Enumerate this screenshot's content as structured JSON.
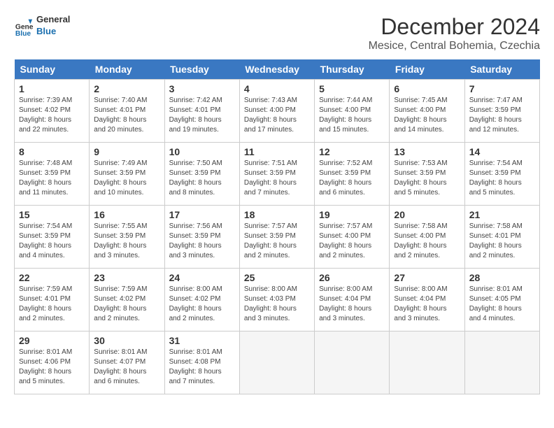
{
  "logo": {
    "line1": "General",
    "line2": "Blue"
  },
  "title": "December 2024",
  "location": "Mesice, Central Bohemia, Czechia",
  "days_header": [
    "Sunday",
    "Monday",
    "Tuesday",
    "Wednesday",
    "Thursday",
    "Friday",
    "Saturday"
  ],
  "weeks": [
    [
      {
        "num": "1",
        "info": "Sunrise: 7:39 AM\nSunset: 4:02 PM\nDaylight: 8 hours\nand 22 minutes."
      },
      {
        "num": "2",
        "info": "Sunrise: 7:40 AM\nSunset: 4:01 PM\nDaylight: 8 hours\nand 20 minutes."
      },
      {
        "num": "3",
        "info": "Sunrise: 7:42 AM\nSunset: 4:01 PM\nDaylight: 8 hours\nand 19 minutes."
      },
      {
        "num": "4",
        "info": "Sunrise: 7:43 AM\nSunset: 4:00 PM\nDaylight: 8 hours\nand 17 minutes."
      },
      {
        "num": "5",
        "info": "Sunrise: 7:44 AM\nSunset: 4:00 PM\nDaylight: 8 hours\nand 15 minutes."
      },
      {
        "num": "6",
        "info": "Sunrise: 7:45 AM\nSunset: 4:00 PM\nDaylight: 8 hours\nand 14 minutes."
      },
      {
        "num": "7",
        "info": "Sunrise: 7:47 AM\nSunset: 3:59 PM\nDaylight: 8 hours\nand 12 minutes."
      }
    ],
    [
      {
        "num": "8",
        "info": "Sunrise: 7:48 AM\nSunset: 3:59 PM\nDaylight: 8 hours\nand 11 minutes."
      },
      {
        "num": "9",
        "info": "Sunrise: 7:49 AM\nSunset: 3:59 PM\nDaylight: 8 hours\nand 10 minutes."
      },
      {
        "num": "10",
        "info": "Sunrise: 7:50 AM\nSunset: 3:59 PM\nDaylight: 8 hours\nand 8 minutes."
      },
      {
        "num": "11",
        "info": "Sunrise: 7:51 AM\nSunset: 3:59 PM\nDaylight: 8 hours\nand 7 minutes."
      },
      {
        "num": "12",
        "info": "Sunrise: 7:52 AM\nSunset: 3:59 PM\nDaylight: 8 hours\nand 6 minutes."
      },
      {
        "num": "13",
        "info": "Sunrise: 7:53 AM\nSunset: 3:59 PM\nDaylight: 8 hours\nand 5 minutes."
      },
      {
        "num": "14",
        "info": "Sunrise: 7:54 AM\nSunset: 3:59 PM\nDaylight: 8 hours\nand 5 minutes."
      }
    ],
    [
      {
        "num": "15",
        "info": "Sunrise: 7:54 AM\nSunset: 3:59 PM\nDaylight: 8 hours\nand 4 minutes."
      },
      {
        "num": "16",
        "info": "Sunrise: 7:55 AM\nSunset: 3:59 PM\nDaylight: 8 hours\nand 3 minutes."
      },
      {
        "num": "17",
        "info": "Sunrise: 7:56 AM\nSunset: 3:59 PM\nDaylight: 8 hours\nand 3 minutes."
      },
      {
        "num": "18",
        "info": "Sunrise: 7:57 AM\nSunset: 3:59 PM\nDaylight: 8 hours\nand 2 minutes."
      },
      {
        "num": "19",
        "info": "Sunrise: 7:57 AM\nSunset: 4:00 PM\nDaylight: 8 hours\nand 2 minutes."
      },
      {
        "num": "20",
        "info": "Sunrise: 7:58 AM\nSunset: 4:00 PM\nDaylight: 8 hours\nand 2 minutes."
      },
      {
        "num": "21",
        "info": "Sunrise: 7:58 AM\nSunset: 4:01 PM\nDaylight: 8 hours\nand 2 minutes."
      }
    ],
    [
      {
        "num": "22",
        "info": "Sunrise: 7:59 AM\nSunset: 4:01 PM\nDaylight: 8 hours\nand 2 minutes."
      },
      {
        "num": "23",
        "info": "Sunrise: 7:59 AM\nSunset: 4:02 PM\nDaylight: 8 hours\nand 2 minutes."
      },
      {
        "num": "24",
        "info": "Sunrise: 8:00 AM\nSunset: 4:02 PM\nDaylight: 8 hours\nand 2 minutes."
      },
      {
        "num": "25",
        "info": "Sunrise: 8:00 AM\nSunset: 4:03 PM\nDaylight: 8 hours\nand 3 minutes."
      },
      {
        "num": "26",
        "info": "Sunrise: 8:00 AM\nSunset: 4:04 PM\nDaylight: 8 hours\nand 3 minutes."
      },
      {
        "num": "27",
        "info": "Sunrise: 8:00 AM\nSunset: 4:04 PM\nDaylight: 8 hours\nand 3 minutes."
      },
      {
        "num": "28",
        "info": "Sunrise: 8:01 AM\nSunset: 4:05 PM\nDaylight: 8 hours\nand 4 minutes."
      }
    ],
    [
      {
        "num": "29",
        "info": "Sunrise: 8:01 AM\nSunset: 4:06 PM\nDaylight: 8 hours\nand 5 minutes."
      },
      {
        "num": "30",
        "info": "Sunrise: 8:01 AM\nSunset: 4:07 PM\nDaylight: 8 hours\nand 6 minutes."
      },
      {
        "num": "31",
        "info": "Sunrise: 8:01 AM\nSunset: 4:08 PM\nDaylight: 8 hours\nand 7 minutes."
      },
      null,
      null,
      null,
      null
    ]
  ]
}
